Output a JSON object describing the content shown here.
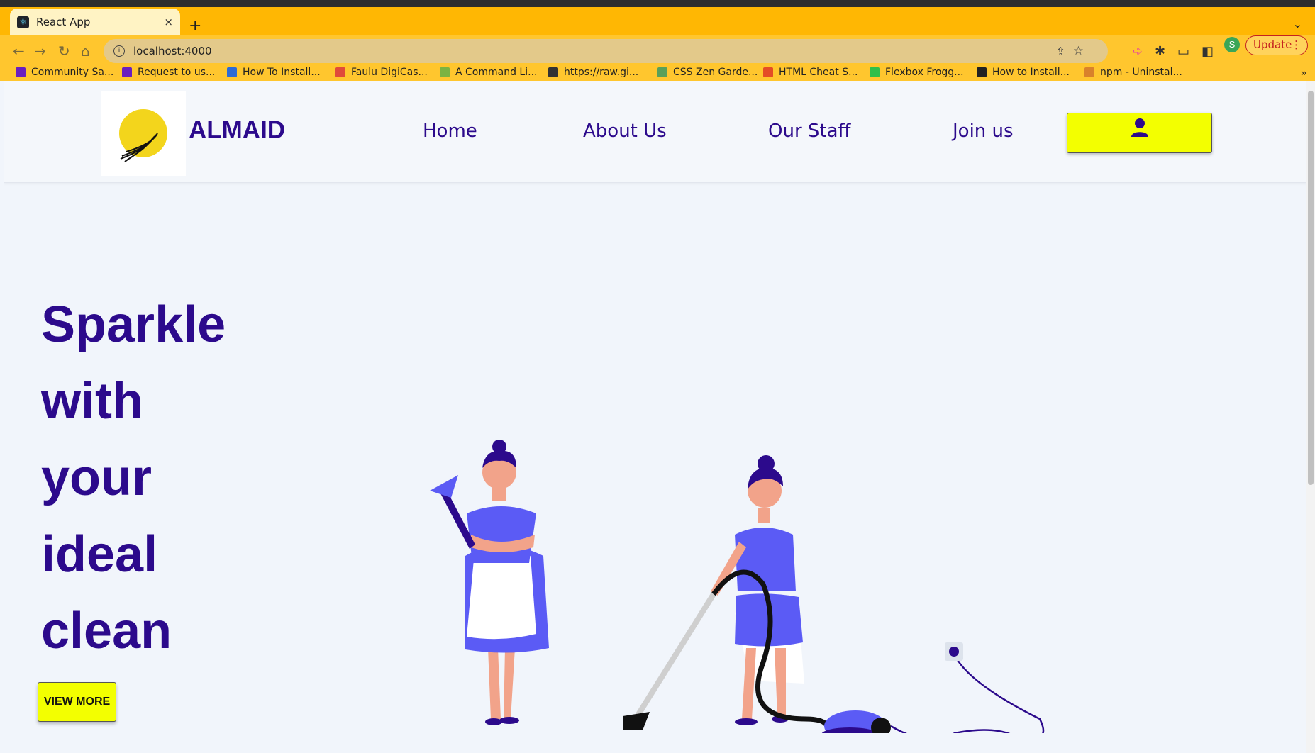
{
  "browser": {
    "tab_title": "React App",
    "tab_close": "×",
    "new_tab": "+",
    "url": "localhost:4000",
    "profile_initial": "S",
    "update_label": "Update",
    "update_menu": "⋮",
    "bookmarks_more": "»",
    "bookmarks": [
      {
        "label": "Community Sa...",
        "color": "#6a1fbf"
      },
      {
        "label": "Request to us...",
        "color": "#6a1fbf"
      },
      {
        "label": "How To Install...",
        "color": "#2d6bd6"
      },
      {
        "label": "Faulu DigiCas...",
        "color": "#e04b3a"
      },
      {
        "label": "A Command Li...",
        "color": "#7cb342"
      },
      {
        "label": "https://raw.gi...",
        "color": "#333333"
      },
      {
        "label": "CSS Zen Garde...",
        "color": "#5aa05a"
      },
      {
        "label": "HTML Cheat S...",
        "color": "#e44d26"
      },
      {
        "label": "Flexbox Frogg...",
        "color": "#2fbf4a"
      },
      {
        "label": "How to Install...",
        "color": "#222222"
      },
      {
        "label": "npm - Uninstal...",
        "color": "#d9822b"
      }
    ]
  },
  "site": {
    "brand": "ALMAID",
    "nav": [
      "Home",
      "About Us",
      "Our Staff",
      "Join us"
    ],
    "user_icon": "user-icon",
    "hero_lines": [
      "Sparkle",
      "with",
      "your",
      "ideal",
      "clean"
    ],
    "cta_label": "VIEW MORE",
    "colors": {
      "primary": "#2c0a8c",
      "accent_yellow": "#f3ff00",
      "background": "#f1f5fb",
      "browser_theme": "#ffb703"
    }
  }
}
